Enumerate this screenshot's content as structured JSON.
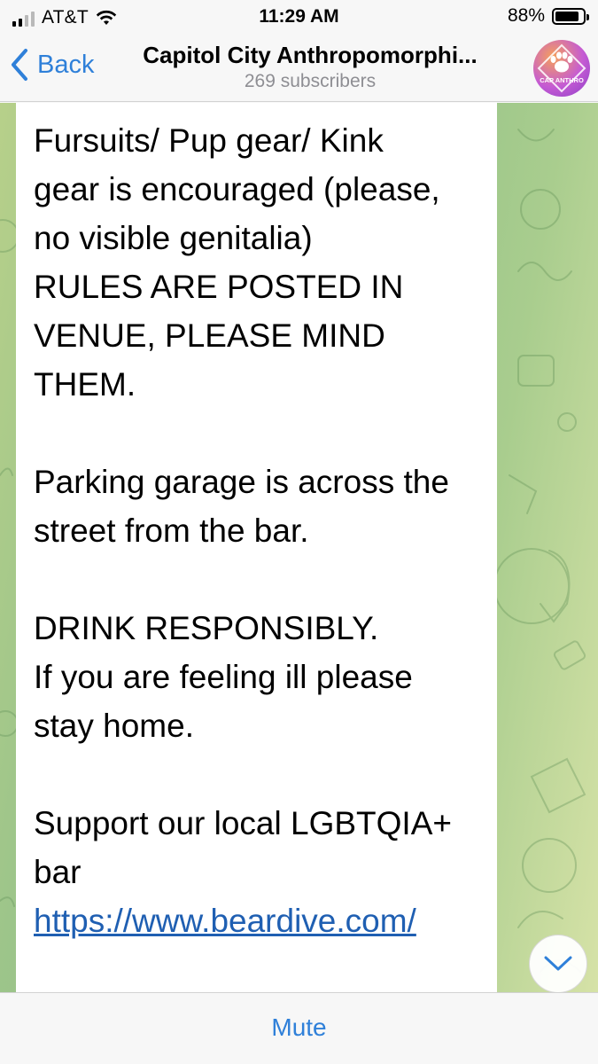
{
  "status_bar": {
    "carrier": "AT&T",
    "time": "11:29 AM",
    "battery_percent": "88%",
    "battery_level": 0.88,
    "signal_bars_active": 2,
    "icons": [
      "signal-icon",
      "wifi-icon",
      "battery-icon"
    ]
  },
  "nav": {
    "back_label": "Back",
    "channel_title": "Capitol City Anthropomorphi...",
    "subscribers": "269 subscribers",
    "avatar_text": "CAP ANTHRO"
  },
  "message": {
    "text": "Fursuits/ Pup gear/ Kink\ngear is encouraged (please,\nno visible genitalia)\nRULES ARE POSTED IN\nVENUE, PLEASE MIND\nTHEM.\n\nParking garage is across the\nstreet from the bar.\n\nDRINK RESPONSIBLY.\nIf you are feeling ill please\nstay home.\n\nSupport our local LGBTQIA+\nbar",
    "link": "https://www.beardive.com/"
  },
  "bottom_bar": {
    "mute_label": "Mute"
  },
  "colors": {
    "accent": "#2f80d9",
    "link": "#1f5fb2",
    "bar_background": "#f7f7f7",
    "chat_background": "#9dc58a"
  }
}
